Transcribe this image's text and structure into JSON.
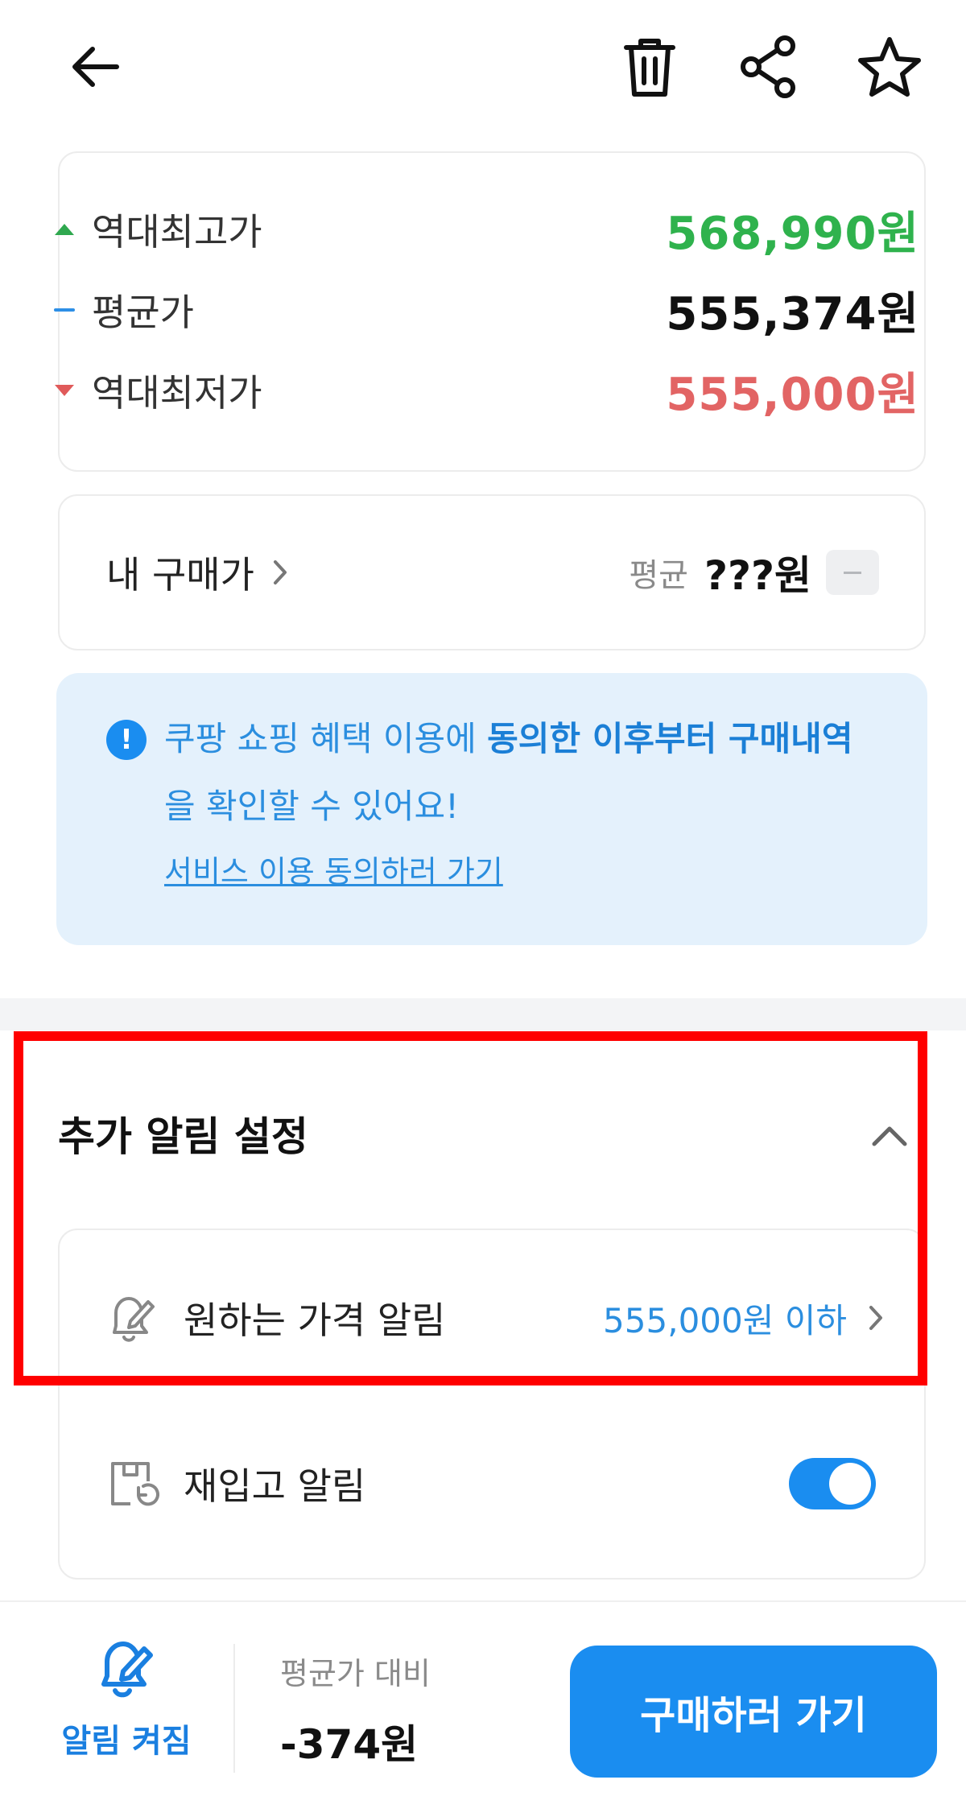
{
  "price_summary": {
    "highest": {
      "label": "역대최고가",
      "value": "568,990원",
      "color": "#2fb24d"
    },
    "average": {
      "label": "평균가",
      "value": "555,374원",
      "color": "#111111"
    },
    "lowest": {
      "label": "역대최저가",
      "value": "555,000원",
      "color": "#e26464"
    }
  },
  "my_purchase": {
    "label": "내 구매가",
    "avg_label": "평균",
    "avg_value": "???원"
  },
  "notice": {
    "text_plain": "쿠팡 쇼핑 혜택 이용에 ",
    "text_bold": "동의한 이후부터 구매내역",
    "text_line2": "을 확인할 수 있어요!",
    "link": "서비스 이용 동의하러 가기"
  },
  "alert_settings": {
    "title": "추가 알림 설정",
    "items": [
      {
        "label": "원하는 가격 알림",
        "value": "555,000원 이하"
      },
      {
        "label": "재입고 알림",
        "toggle": true
      }
    ]
  },
  "bottom": {
    "bell_label": "알림 켜짐",
    "compare_label": "평균가 대비",
    "compare_value": "-374원",
    "buy_label": "구매하러 가기"
  },
  "colors": {
    "accent": "#1a8df0",
    "highlight": "#ff0000"
  }
}
